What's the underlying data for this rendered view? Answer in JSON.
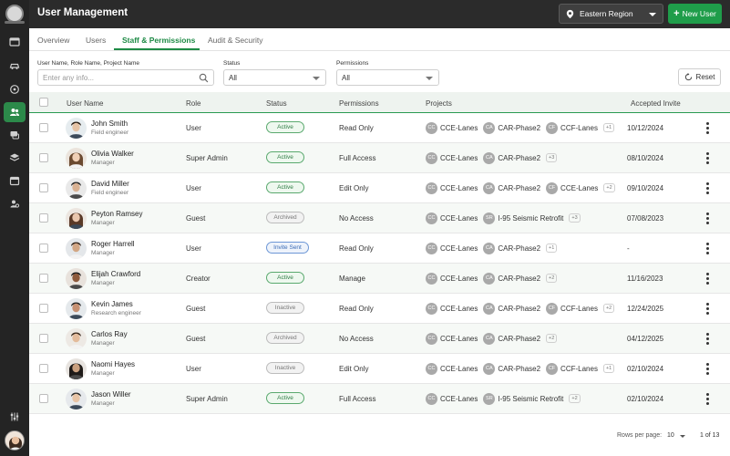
{
  "header": {
    "title": "User Management",
    "region": "Eastern Region",
    "new_user_label": "New User",
    "colors": {
      "header_bg": "#2b2b2b",
      "accent": "#1f9d4a"
    }
  },
  "sidebar": {
    "items": [
      {
        "icon": "dashboard-icon"
      },
      {
        "icon": "vehicle-icon"
      },
      {
        "icon": "location-icon"
      },
      {
        "icon": "users-icon",
        "active": true
      },
      {
        "icon": "chat-icon"
      },
      {
        "icon": "layers-icon"
      },
      {
        "icon": "calendar-icon"
      },
      {
        "icon": "settings-icon"
      }
    ],
    "bottom_icon": "sliders-icon"
  },
  "tabs": [
    {
      "label": "Overview"
    },
    {
      "label": "Users"
    },
    {
      "label": "Staff & Permissions",
      "active": true
    },
    {
      "label": "Audit & Security"
    }
  ],
  "filters": {
    "search_label": "User Name, Role Name, Project Name",
    "search_placeholder": "Enter any info...",
    "status_label": "Status",
    "status_value": "All",
    "permissions_label": "Permissions",
    "permissions_value": "All",
    "reset_label": "Reset"
  },
  "table": {
    "columns": [
      "User Name",
      "Role",
      "Status",
      "Permissions",
      "Projects",
      "Accepted Invite"
    ],
    "rows": [
      {
        "name": "John Smith",
        "title": "Field engineer",
        "role": "User",
        "status": "Active",
        "permissions": "Read Only",
        "projects": [
          {
            "abbr": "CC",
            "name": "CCE-Lanes"
          },
          {
            "abbr": "CA",
            "name": "CAR-Phase2"
          },
          {
            "abbr": "CF",
            "name": "CCF-Lanes"
          }
        ],
        "more": "+1",
        "accepted": "10/12/2024"
      },
      {
        "name": "Olivia Walker",
        "title": "Manager",
        "role": "Super Admin",
        "status": "Active",
        "permissions": "Full Access",
        "projects": [
          {
            "abbr": "CC",
            "name": "CCE-Lanes"
          },
          {
            "abbr": "CA",
            "name": "CAR-Phase2"
          }
        ],
        "more": "+3",
        "accepted": "08/10/2024"
      },
      {
        "name": "David Miller",
        "title": "Field engineer",
        "role": "User",
        "status": "Active",
        "permissions": "Edit Only",
        "projects": [
          {
            "abbr": "CC",
            "name": "CCE-Lanes"
          },
          {
            "abbr": "CA",
            "name": "CAR-Phase2"
          },
          {
            "abbr": "CF",
            "name": "CCE-Lanes"
          }
        ],
        "more": "+2",
        "accepted": "09/10/2024"
      },
      {
        "name": "Peyton Ramsey",
        "title": "Manager",
        "role": "Guest",
        "status": "Archived",
        "permissions": "No Access",
        "projects": [
          {
            "abbr": "CC",
            "name": "CCE-Lanes"
          },
          {
            "abbr": "SR",
            "name": "I-95 Seismic Retrofit"
          }
        ],
        "more": "+3",
        "accepted": "07/08/2023"
      },
      {
        "name": "Roger Harrell",
        "title": "Manager",
        "role": "User",
        "status": "Invite Sent",
        "permissions": "Read Only",
        "projects": [
          {
            "abbr": "CC",
            "name": "CCE-Lanes"
          },
          {
            "abbr": "CA",
            "name": "CAR-Phase2"
          }
        ],
        "more": "+1",
        "accepted": "-"
      },
      {
        "name": "Elijah Crawford",
        "title": "Manager",
        "role": "Creator",
        "status": "Active",
        "permissions": "Manage",
        "projects": [
          {
            "abbr": "CC",
            "name": "CCE-Lanes"
          },
          {
            "abbr": "CA",
            "name": "CAR-Phase2"
          }
        ],
        "more": "+2",
        "accepted": "11/16/2023"
      },
      {
        "name": "Kevin James",
        "title": "Research engineer",
        "role": "Guest",
        "status": "Inactive",
        "permissions": "Read Only",
        "projects": [
          {
            "abbr": "CC",
            "name": "CCE-Lanes"
          },
          {
            "abbr": "CA",
            "name": "CAR-Phase2"
          },
          {
            "abbr": "CF",
            "name": "CCF-Lanes"
          }
        ],
        "more": "+2",
        "accepted": "12/24/2025"
      },
      {
        "name": "Carlos Ray",
        "title": "Manager",
        "role": "Guest",
        "status": "Archived",
        "permissions": "No Access",
        "projects": [
          {
            "abbr": "CC",
            "name": "CCE-Lanes"
          },
          {
            "abbr": "CA",
            "name": "CAR-Phase2"
          }
        ],
        "more": "+2",
        "accepted": "04/12/2025"
      },
      {
        "name": "Naomi Hayes",
        "title": "Manager",
        "role": "User",
        "status": "Inactive",
        "permissions": "Edit Only",
        "projects": [
          {
            "abbr": "CC",
            "name": "CCE-Lanes"
          },
          {
            "abbr": "CA",
            "name": "CAR-Phase2"
          },
          {
            "abbr": "CF",
            "name": "CCF-Lanes"
          }
        ],
        "more": "+1",
        "accepted": "02/10/2024"
      },
      {
        "name": "Jason Willer",
        "title": "Manager",
        "role": "Super Admin",
        "status": "Active",
        "permissions": "Full Access",
        "projects": [
          {
            "abbr": "CC",
            "name": "CCE-Lanes"
          },
          {
            "abbr": "SR",
            "name": "I-95 Seismic Retrofit"
          }
        ],
        "more": "+2",
        "accepted": "02/10/2024"
      }
    ]
  },
  "footer": {
    "rows_per_page_label": "Rows per page:",
    "rows_per_page": "10",
    "page_info": "1 of 13"
  }
}
